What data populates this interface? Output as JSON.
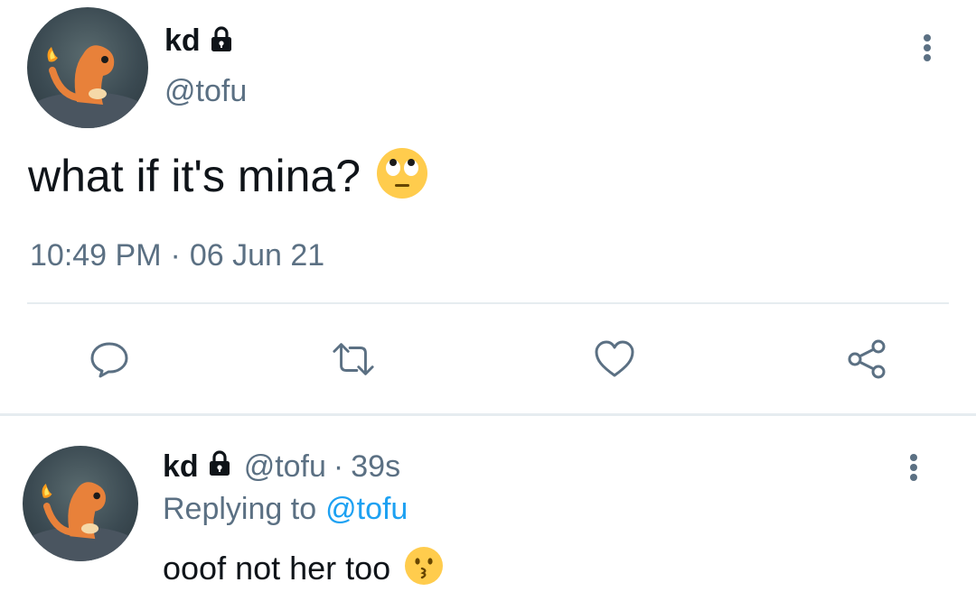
{
  "main_tweet": {
    "display_name": "kd",
    "handle": "@tofu",
    "text": "what if it's mina?",
    "emoji": "face-with-rolling-eyes",
    "time": "10:49 PM",
    "separator": "·",
    "date": "06 Jun 21"
  },
  "actions": {
    "reply": "speech-bubble-icon",
    "retweet": "retweet-icon",
    "like": "heart-icon",
    "share": "share-icon"
  },
  "reply_tweet": {
    "display_name": "kd",
    "handle": "@tofu",
    "separator": "·",
    "age": "39s",
    "replying_prefix": "Replying to",
    "replying_handle": "@tofu",
    "text": "ooof not her too",
    "emoji": "kissing-face"
  },
  "colors": {
    "text": "#0f1419",
    "muted": "#5b7083",
    "link": "#1da1f2",
    "divider": "#e6ecf0"
  }
}
